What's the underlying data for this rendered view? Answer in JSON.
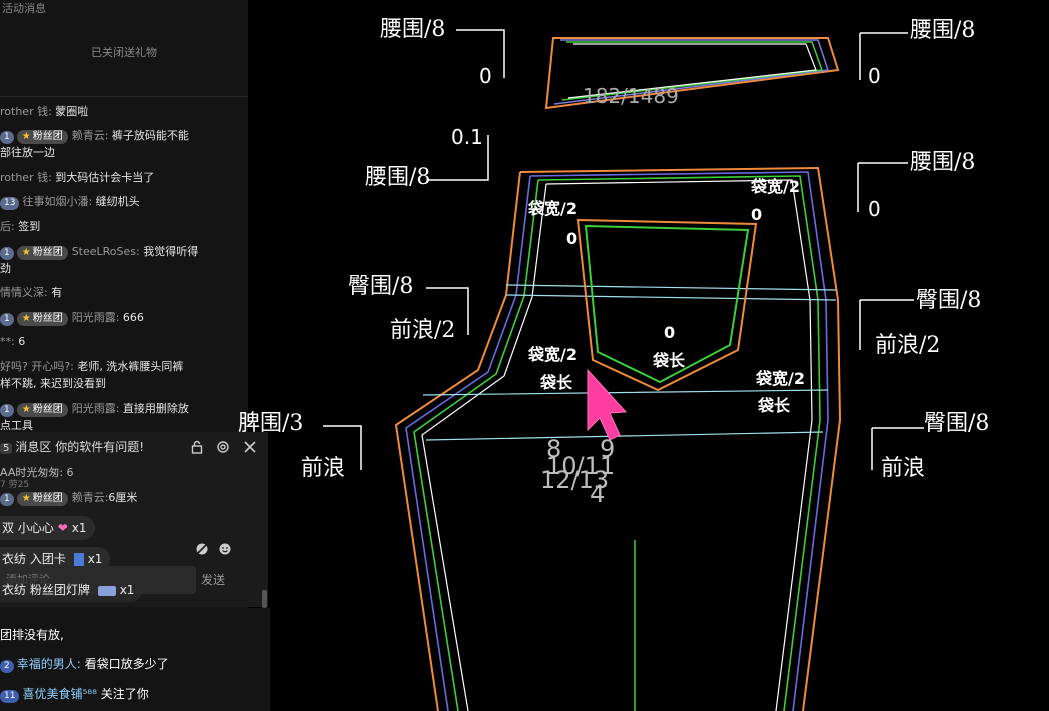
{
  "chat": {
    "top_notice": "活动消息",
    "gift_off": "已关闭送礼物",
    "messages": [
      {
        "level": "",
        "badge": "",
        "user": "rother 钱:",
        "text": "蒙圈啦"
      },
      {
        "level": "1",
        "badge": "粉丝团",
        "user": "赖青云:",
        "text": "裤子放码能不能"
      },
      {
        "level": "",
        "badge": "",
        "user": "",
        "text": "部往放一边"
      },
      {
        "level": "",
        "badge": "",
        "user": "rother 钱:",
        "text": "到大码估计会卡当了"
      },
      {
        "level": "13",
        "badge": "",
        "user": "往事如烟小潘:",
        "text": "缝纫机头"
      },
      {
        "level": "",
        "badge": "",
        "user": "后:",
        "text": "签到"
      },
      {
        "level": "1",
        "badge": "粉丝团",
        "user": "SteeLRoSes:",
        "text": "我觉得听得"
      },
      {
        "level": "",
        "badge": "",
        "user": "",
        "text": "劲"
      },
      {
        "level": "",
        "badge": "",
        "user": "情情义深:",
        "text": "有"
      },
      {
        "level": "1",
        "badge": "粉丝团",
        "user": "阳光雨露:",
        "text": "666"
      },
      {
        "level": "",
        "badge": "",
        "user": "**:",
        "text": "6"
      },
      {
        "level": "",
        "badge": "",
        "user": "好吗? 开心吗?:",
        "text": "老师, 洗水裤腰头同裤"
      },
      {
        "level": "",
        "badge": "",
        "user": "",
        "text": "样不跳, 来迟到没看到"
      },
      {
        "level": "1",
        "badge": "粉丝团",
        "user": "阳光雨露:",
        "text": "直接用删除放"
      },
      {
        "level": "",
        "badge": "",
        "user": "",
        "text": "点工具"
      }
    ]
  },
  "msg_panel": {
    "count": "5",
    "title": "消息区",
    "text": "你的软件有问题!",
    "line_a": "AA时光匆匆: 6",
    "line_b": "7  劳25",
    "fan_level": "1",
    "fan_badge": "粉丝团",
    "fan_user": "赖青云:",
    "fan_text": "6厘米",
    "extra": "2",
    "gifts": [
      {
        "user": "双",
        "item": "小心心",
        "icon": "heart-icon",
        "count": "x1"
      },
      {
        "user": "衣纺",
        "item": "入团卡",
        "icon": "card-icon",
        "count": "x1"
      },
      {
        "user": "衣纺",
        "item": "粉丝团灯牌",
        "icon": "lightboard-icon",
        "count": "x1"
      }
    ],
    "input_placeholder": "添加评论",
    "send": "发送"
  },
  "bottom_chat": [
    {
      "level": "",
      "name": "",
      "text": "团排没有放,"
    },
    {
      "level": "2",
      "name": "幸福的男人:",
      "text": "看袋口放多少了"
    },
    {
      "level": "11",
      "name": "喜优美食铺⁵⁸⁸",
      "text": "关注了你"
    }
  ],
  "cad": {
    "waistband_code": "182/1489",
    "labels": {
      "wb_left": "腰围/8",
      "wb_left_zero": "0",
      "wb_right": "腰围/8",
      "wb_right_zero": "0",
      "point_one": "0.1",
      "waist_left": "腰围/8",
      "waist_right": "腰围/8",
      "waist_right_zero": "0",
      "pocket_w_left": "袋宽/2",
      "pocket_w_left_zero": "0",
      "pocket_w_right": "袋宽/2",
      "pocket_w_right_zero": "0",
      "hip_left": "臀围/8",
      "hip_right": "臀围/8",
      "rise_left": "前浪/2",
      "rise_right": "前浪/2",
      "pocket_zero_mid": "0",
      "pocket_len_mid": "袋长",
      "pocket_w_mid": "袋宽/2",
      "pocket_len_left": "袋长",
      "pocket_w_r2": "袋宽/2",
      "pocket_len_r2": "袋长",
      "thigh_left": "脾围/3",
      "hip_right2": "臀围/8",
      "rise_left2": "前浪",
      "rise_right2": "前浪"
    },
    "size_numbers": {
      "a": "8",
      "b": "10/11",
      "c": "9",
      "d": "12/13",
      "e": "4"
    }
  }
}
